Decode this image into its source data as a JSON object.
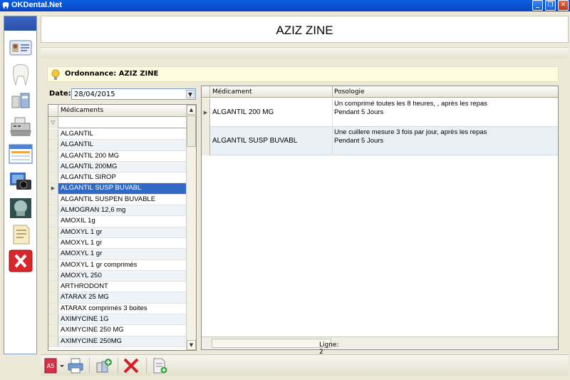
{
  "window": {
    "title": "OKDental.Net",
    "buttons": [
      "_",
      "❐",
      "✕"
    ]
  },
  "patient": {
    "name": "AZIZ ZINE"
  },
  "ordonnance": {
    "label": "Ordonnance:  AZIZ ZINE"
  },
  "date": {
    "label": "Date:",
    "value": "28/04/2015"
  },
  "medlist": {
    "header": "Médicaments",
    "items": [
      "ALGANTIL",
      "ALGANTIL",
      "ALGANTIL 200 MG",
      "ALGANTIL 200MG",
      "ALGANTIL SIROP",
      "ALGANTIL SUSP BUVABL",
      "ALGANTIL SUSPEN BUVABLE",
      "ALMOGRAN 12,6 mg",
      "AMOXIL 1g",
      "AMOXYL 1 gr",
      "AMOXYL 1 gr",
      "AMOXYL 1 gr",
      "AMOXYL 1 gr comprimés",
      "AMOXYL 250",
      "ARTHRODONT",
      "ATARAX 25 MG",
      "ATARAX comprimés 3 boites",
      "AXIMYCINE 1G",
      "AXIMYCINE 250 MG",
      "AXIMYCINE 250MG"
    ],
    "selected_index": 5
  },
  "prescription": {
    "headers": {
      "medicament": "Médicament",
      "posologie": "Posologie"
    },
    "rows": [
      {
        "medicament": "ALGANTIL 200 MG",
        "posologie": "Un comprimé toutes les 8 heures, , après les repas\nPendant 5 Jours"
      },
      {
        "medicament": "ALGANTIL SUSP BUVABL",
        "posologie": "Une cuillere mesure 3 fois par jour, après les repas\nPendant 5 Jours"
      }
    ],
    "footer": "Ligne: 2"
  },
  "toolbar": {
    "format_badge": "A5"
  }
}
